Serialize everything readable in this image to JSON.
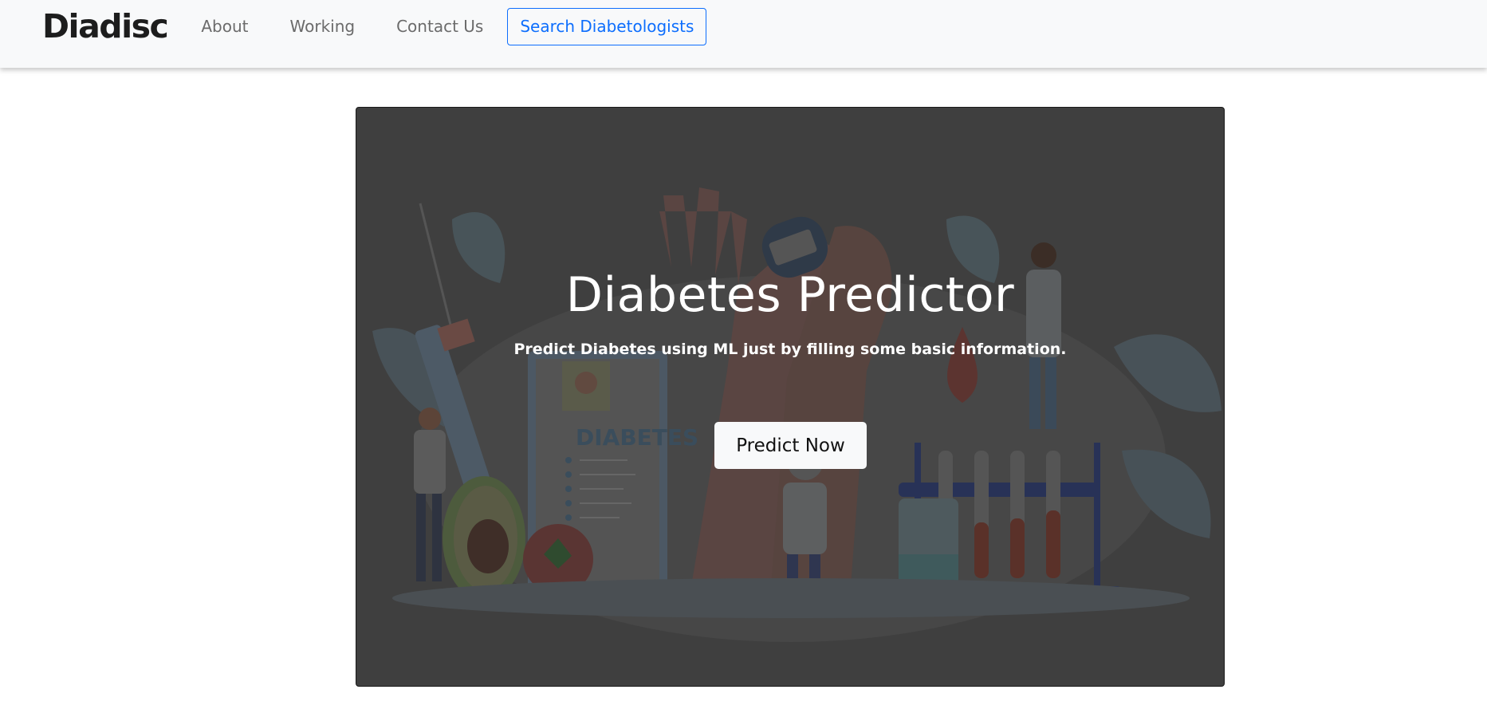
{
  "navbar": {
    "brand": "Diadisc",
    "links": [
      {
        "label": "About"
      },
      {
        "label": "Working"
      },
      {
        "label": "Contact Us"
      }
    ],
    "search_button": "Search Diabetologists",
    "accent_color": "#0d6efd"
  },
  "hero": {
    "title": "Diabetes Predictor",
    "subtitle": "Predict Diabetes using ML just by filling some basic information.",
    "cta_label": "Predict Now",
    "illustration_text": "DIABETES",
    "overlay_color": "#3f3f3f"
  }
}
